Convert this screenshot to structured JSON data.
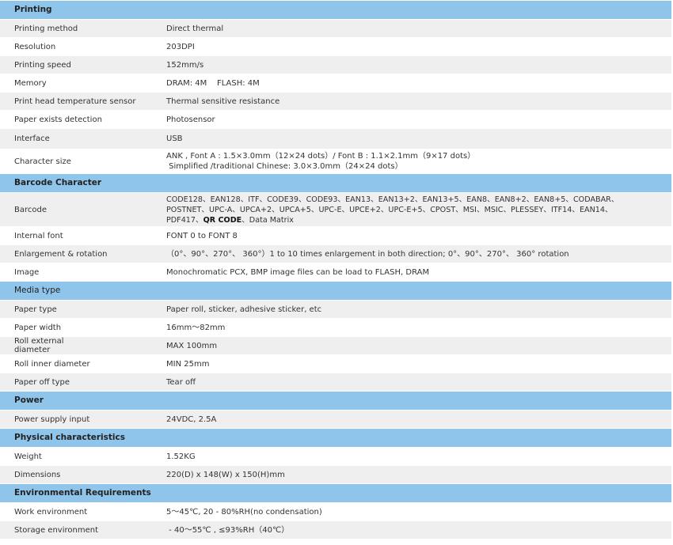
{
  "sections": [
    {
      "title": "Printing",
      "rows": [
        {
          "key": "Printing method",
          "value": "Direct thermal"
        },
        {
          "key": "Resolution",
          "value": "203DPI"
        },
        {
          "key": "Printing speed",
          "value": "152mm/s"
        },
        {
          "key": "Memory",
          "value": "DRAM: 4M    FLASH: 4M"
        },
        {
          "key": "Print head temperature sensor",
          "value": "Thermal sensitive resistance"
        },
        {
          "key": "Paper exists detection",
          "value": "Photosensor"
        },
        {
          "key": "Interface",
          "value": "USB"
        },
        {
          "key": "Character size",
          "line1": "ANK , Font A : 1.5×3.0mm（12×24 dots）/ Font B : 1.1×2.1mm（9×17 dots）",
          "line2": " Simplified /traditional Chinese: 3.0×3.0mm（24×24 dots）"
        }
      ]
    },
    {
      "title": "Barcode Character",
      "rows": [
        {
          "key": "Barcode",
          "line1": "CODE128、EAN128、ITF、CODE39、CODE93、EAN13、EAN13+2、EAN13+5、EAN8、EAN8+2、EAN8+5、CODABAR、",
          "line2": "POSTNET、UPC-A、UPCA+2、UPCA+5、UPC-E、UPCE+2、UPC-E+5、CPOST、MSI、MSIC、PLESSEY、ITF14、EAN14、",
          "line3a": "PDF417、",
          "line3b": "QR CODE",
          "line3c": "、Data Matrix"
        },
        {
          "key": "Internal font",
          "value": "FONT 0 to FONT 8"
        },
        {
          "key": "Enlargement & rotation",
          "value": "（0°、90°、270°、 360°）1 to 10 times enlargement in both direction; 0°、90°、270°、 360° rotation"
        },
        {
          "key": "Image",
          "value": "Monochromatic PCX, BMP image files can be load to FLASH, DRAM"
        }
      ]
    },
    {
      "title": "Media type",
      "rows": [
        {
          "key": "Paper type",
          "value": "Paper roll, sticker, adhesive sticker, etc"
        },
        {
          "key": "Paper width",
          "value": "16mm～82mm"
        },
        {
          "key": "Roll external diameter",
          "value": "MAX 100mm"
        },
        {
          "key": "Roll inner diameter",
          "value": "MIN 25mm"
        },
        {
          "key": "Paper off type",
          "value": "Tear off"
        }
      ]
    },
    {
      "title": "Power",
      "rows": [
        {
          "key": "Power supply input",
          "value": "24VDC, 2.5A"
        }
      ]
    },
    {
      "title": "Physical characteristics",
      "rows": [
        {
          "key": "Weight",
          "value": "1.52KG"
        },
        {
          "key": "Dimensions",
          "value": "220(D) x 148(W) x 150(H)mm"
        }
      ]
    },
    {
      "title": "Environmental Requirements",
      "rows": [
        {
          "key": "Work environment",
          "value": "5～45℃, 20 - 80%RH(no condensation)"
        },
        {
          "key": "Storage environment",
          "value": " - 40～55℃ , ≤93%RH（40℃）"
        }
      ]
    }
  ],
  "colors": {
    "header_bg": "#8fc5ea",
    "alt_row_bg": "#efefef"
  }
}
